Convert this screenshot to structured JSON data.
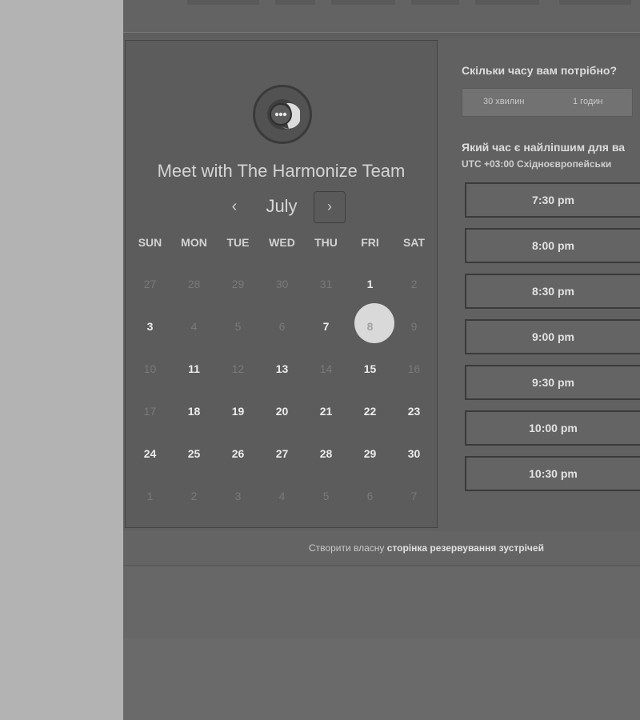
{
  "header": {
    "title": "Meet with The Harmonize Team"
  },
  "calendar": {
    "month": "July",
    "prev_icon": "‹",
    "next_icon": "›",
    "weekdays": [
      "SUN",
      "MON",
      "TUE",
      "WED",
      "THU",
      "FRI",
      "SAT"
    ],
    "weeks": [
      [
        "27",
        "28",
        "29",
        "30",
        "31",
        "1",
        "2"
      ],
      [
        "3",
        "4",
        "5",
        "6",
        "7",
        "8",
        "9"
      ],
      [
        "10",
        "11",
        "12",
        "13",
        "14",
        "15",
        "16"
      ],
      [
        "17",
        "18",
        "19",
        "20",
        "21",
        "22",
        "23"
      ],
      [
        "24",
        "25",
        "26",
        "27",
        "28",
        "29",
        "30"
      ],
      [
        "1",
        "2",
        "3",
        "4",
        "5",
        "6",
        "7"
      ]
    ],
    "selected": "8"
  },
  "booking": {
    "duration_question": "Скільки часу вам потрібно?",
    "durations": [
      "30 хвилин",
      "1 годин"
    ],
    "time_question": "Який час є найліпшим для ва",
    "timezone": "UTC +03:00 Східноєвропейськи",
    "slots": [
      "7:30 pm",
      "8:00 pm",
      "8:30 pm",
      "9:00 pm",
      "9:30 pm",
      "10:00 pm",
      "10:30 pm"
    ]
  },
  "footer": {
    "prefix": "Створити власну",
    "link": "сторінка резервування зустрічей"
  },
  "icons": {
    "avatar": "chat-bubble-icon"
  },
  "colors": {
    "selected_day": "#d9d9d9",
    "page_bg": "#6a6a6a",
    "card_left": "#5c5c5c"
  }
}
